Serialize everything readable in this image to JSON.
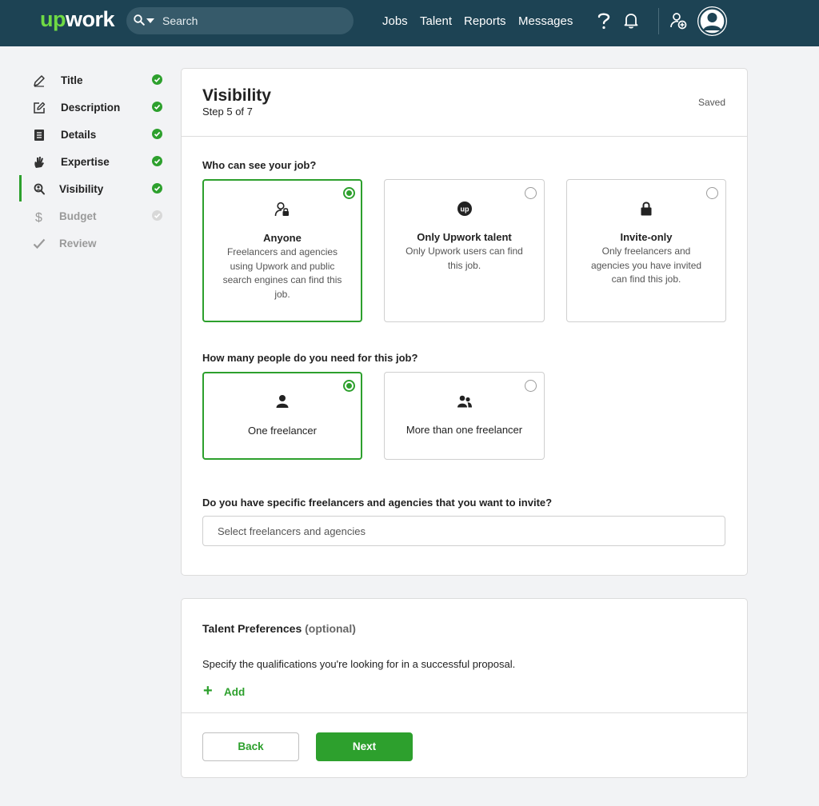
{
  "header": {
    "logo_up": "up",
    "logo_work": "work",
    "search_placeholder": "Search",
    "nav": [
      "Jobs",
      "Talent",
      "Reports",
      "Messages"
    ]
  },
  "sidebar": {
    "items": [
      {
        "label": "Title",
        "status": "complete"
      },
      {
        "label": "Description",
        "status": "complete"
      },
      {
        "label": "Details",
        "status": "complete"
      },
      {
        "label": "Expertise",
        "status": "complete"
      },
      {
        "label": "Visibility",
        "status": "complete",
        "active": true
      },
      {
        "label": "Budget",
        "status": "pending"
      },
      {
        "label": "Review",
        "status": "pending"
      }
    ]
  },
  "visibility": {
    "title": "Visibility",
    "step": "Step 5 of 7",
    "saved": "Saved",
    "q_who": "Who can see your job?",
    "who_options": [
      {
        "title": "Anyone",
        "desc": "Freelancers and agencies using Upwork and public search engines can find this job.",
        "selected": true,
        "icon": "person-lock-icon"
      },
      {
        "title": "Only Upwork talent",
        "desc": "Only Upwork users can find this job.",
        "selected": false,
        "icon": "upwork-badge-icon"
      },
      {
        "title": "Invite-only",
        "desc": "Only freelancers and agencies you have invited can find this job.",
        "selected": false,
        "icon": "lock-icon"
      }
    ],
    "q_how_many": "How many people do you need for this job?",
    "count_options": [
      {
        "label": "One freelancer",
        "selected": true,
        "icon": "person-icon"
      },
      {
        "label": "More than one freelancer",
        "selected": false,
        "icon": "people-icon"
      }
    ],
    "q_invite": "Do you have specific freelancers and agencies that you want to invite?",
    "invite_placeholder": "Select freelancers and agencies"
  },
  "talent_prefs": {
    "title": "Talent Preferences",
    "optional": "(optional)",
    "desc": "Specify the qualifications you're looking for in a successful proposal.",
    "add_label": "Add"
  },
  "footer": {
    "back_label": "Back",
    "next_label": "Next"
  },
  "colors": {
    "brand_green": "#2da02d",
    "header_bg": "#1d4354",
    "logo_green": "#6fda44"
  }
}
